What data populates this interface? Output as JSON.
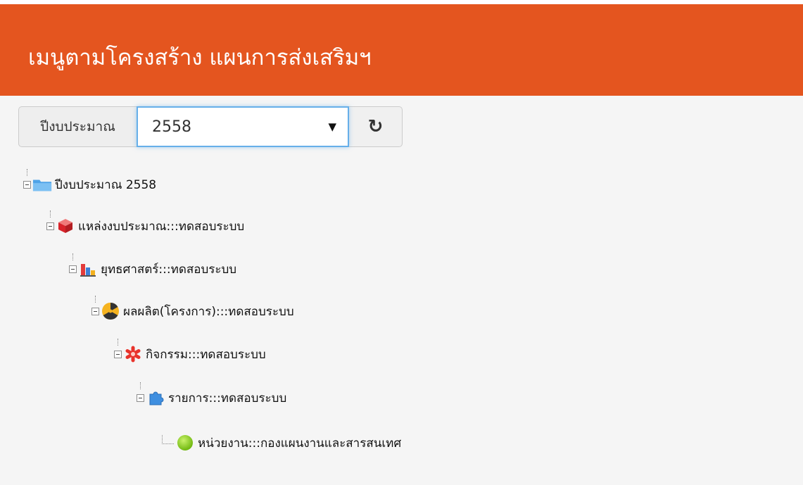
{
  "header": {
    "title": "เมนูตามโครงสร้าง แผนการส่งเสริมฯ"
  },
  "toolbar": {
    "label": "ปีงบประมาณ",
    "selected_year": "2558",
    "caret": "▼",
    "refresh_icon": "refresh-icon"
  },
  "tree": {
    "nodes": [
      {
        "label": "ปีงบประมาณ 2558",
        "icon": "folder-icon",
        "expanded": true
      },
      {
        "label": "แหล่งงบประมาณ:::ทดสอบระบบ",
        "icon": "red-cube-icon",
        "expanded": true
      },
      {
        "label": "ยุทธศาสตร์:::ทดสอบระบบ",
        "icon": "bar-chart-icon",
        "expanded": true
      },
      {
        "label": "ผลผลิต(โครงการ):::ทดสอบระบบ",
        "icon": "radiation-icon",
        "expanded": true
      },
      {
        "label": "กิจกรรม:::ทดสอบระบบ",
        "icon": "red-asterisk-icon",
        "expanded": true
      },
      {
        "label": "รายการ:::ทดสอบระบบ",
        "icon": "puzzle-icon",
        "expanded": true
      },
      {
        "label": "หน่วยงาน:::กองแผนงานและสารสนเทศ",
        "icon": "green-dot-icon",
        "expanded": false
      }
    ]
  },
  "colors": {
    "header_bg": "#e4551f",
    "focus_border": "#66afe9"
  }
}
